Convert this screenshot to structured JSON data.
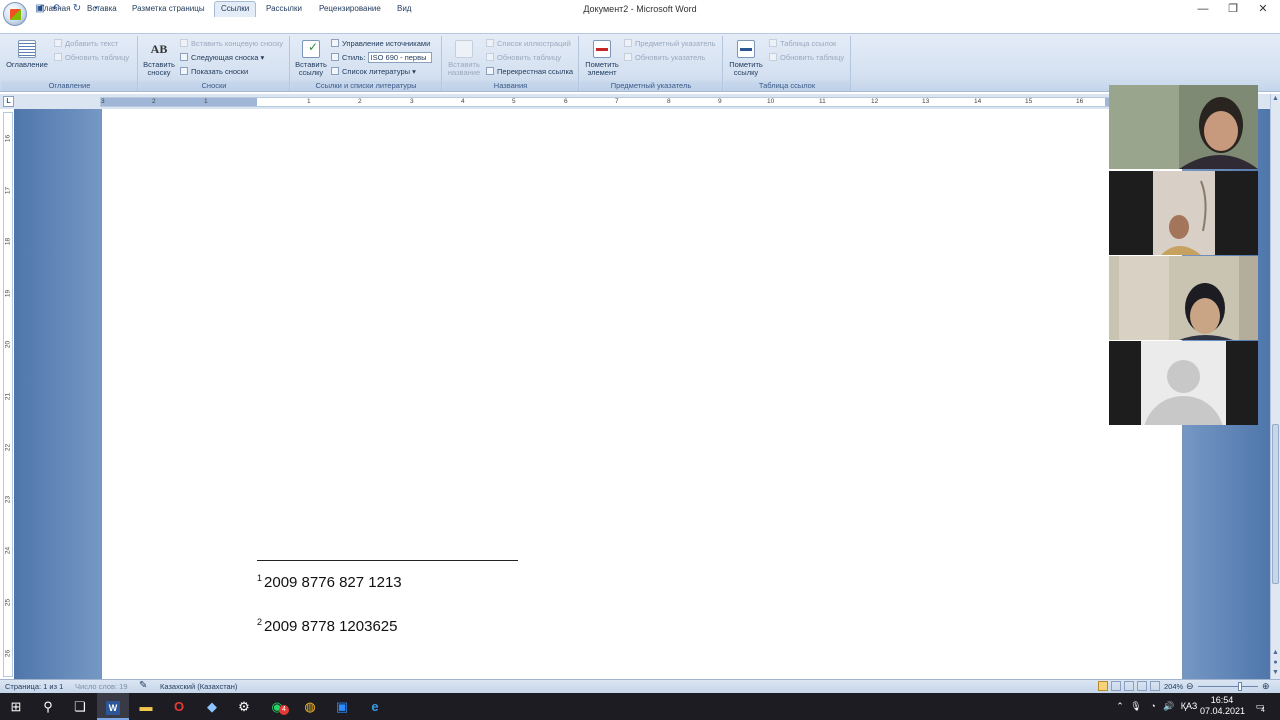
{
  "window": {
    "title": "Документ2 - Microsoft Word",
    "minimize_icon": "minimize-icon",
    "restore_icon": "restore-icon",
    "close_icon": "close-icon"
  },
  "quick_access": [
    "save-icon",
    "undo-icon",
    "redo-icon",
    "customize-icon"
  ],
  "tabs": [
    {
      "label": "Главная",
      "active": false
    },
    {
      "label": "Вставка",
      "active": false
    },
    {
      "label": "Разметка страницы",
      "active": false
    },
    {
      "label": "Ссылки",
      "active": true
    },
    {
      "label": "Рассылки",
      "active": false
    },
    {
      "label": "Рецензирование",
      "active": false
    },
    {
      "label": "Вид",
      "active": false
    }
  ],
  "ribbon": {
    "toc": {
      "group": "Оглавление",
      "big": "Оглавление",
      "add_text": "Добавить текст",
      "update_table": "Обновить таблицу"
    },
    "footnotes": {
      "group": "Сноски",
      "big_line1": "Вставить",
      "big_line2": "сноску",
      "big_icon_text": "AB",
      "insert_endnote": "Вставить концевую сноску",
      "next_footnote": "Следующая сноска",
      "show_notes": "Показать сноски"
    },
    "citations": {
      "group": "Ссылки и списки литературы",
      "big_line1": "Вставить",
      "big_line2": "ссылку",
      "manage_sources": "Управление источниками",
      "style_label": "Стиль:",
      "style_value": "ISO 690 - первы",
      "bibliography": "Список литературы"
    },
    "captions": {
      "group": "Названия",
      "big_line1": "Вставить",
      "big_line2": "название",
      "table_of_figures": "Список иллюстраций",
      "update_table": "Обновить таблицу",
      "cross_reference": "Перекрестная ссылка"
    },
    "index": {
      "group": "Предметный указатель",
      "big_line1": "Пометить",
      "big_line2": "элемент",
      "insert_index": "Предметный указатель",
      "update_index": "Обновить указатель"
    },
    "authorities": {
      "group": "Таблица ссылок",
      "big_line1": "Пометить",
      "big_line2": "ссылку",
      "insert_table": "Таблица ссылок",
      "update_table": "Обновить таблицу"
    }
  },
  "ruler": {
    "corner": "L",
    "h_numbers": [
      "3",
      "2",
      "1",
      "1",
      "2",
      "3",
      "4",
      "5",
      "6",
      "7",
      "8",
      "9",
      "10",
      "11",
      "12",
      "13",
      "14",
      "15",
      "16"
    ],
    "v_numbers": [
      "16",
      "17",
      "18",
      "19",
      "20",
      "21",
      "22",
      "23",
      "24",
      "25",
      "26"
    ]
  },
  "document": {
    "footnotes": [
      {
        "num": "1",
        "text": "2009 8776 827 1213"
      },
      {
        "num": "2",
        "text": "2009 8778 1203625"
      }
    ]
  },
  "video_participants": [
    {
      "name": "participant-1",
      "camera": true
    },
    {
      "name": "participant-2",
      "camera": true
    },
    {
      "name": "participant-3",
      "camera": true
    },
    {
      "name": "participant-4",
      "camera": false
    }
  ],
  "status": {
    "page": "Страница: 1 из 1",
    "words": "Число слов: 19",
    "language": "Казахский (Казахстан)",
    "zoom": "204%"
  },
  "taskbar": {
    "apps": [
      "windows-start-icon",
      "search-icon",
      "task-view-icon",
      "word-icon",
      "file-explorer-icon",
      "opera-icon",
      "app-icon",
      "settings-icon",
      "whatsapp-icon",
      "chrome-icon",
      "zoom-icon",
      "edge-icon"
    ],
    "whatsapp_badge": "4",
    "lang": "ҚАЗ",
    "time": "16:54",
    "date": "07.04.2021",
    "notif_count": "4"
  },
  "colors": {
    "accent": "#2b5797",
    "ribbon_bg": "#dbe6f4",
    "workspace": "#a9c1e0"
  }
}
